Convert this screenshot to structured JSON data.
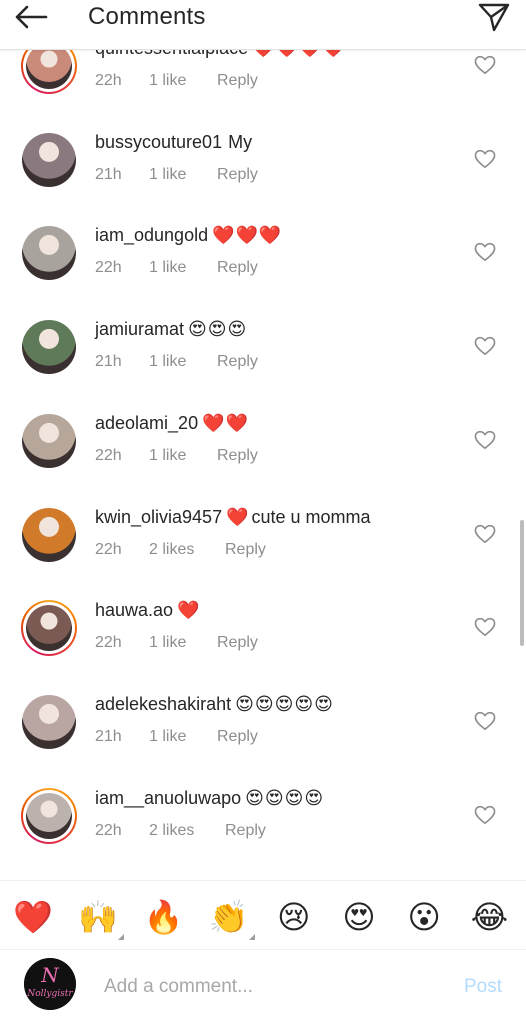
{
  "header": {
    "title": "Comments",
    "back_icon": "arrow-left-icon",
    "send_icon": "paper-plane-icon"
  },
  "comments": [
    {
      "username": "quintessentialplace",
      "text": "",
      "emoji": "❤️❤️❤️❤️",
      "time": "22h",
      "likes": "1 like",
      "reply": "Reply",
      "story_ring": true,
      "avatar_color": "#c98a7a"
    },
    {
      "username": "bussycouture01",
      "text": "My",
      "emoji": "",
      "time": "21h",
      "likes": "1 like",
      "reply": "Reply",
      "story_ring": false,
      "avatar_color": "#8a7a80"
    },
    {
      "username": "iam_odungold",
      "text": "",
      "emoji": "❤️❤️❤️",
      "time": "22h",
      "likes": "1 like",
      "reply": "Reply",
      "story_ring": false,
      "avatar_color": "#a8a39c"
    },
    {
      "username": "jamiuramat",
      "text": "",
      "emoji": "😍😍😍",
      "time": "21h",
      "likes": "1 like",
      "reply": "Reply",
      "story_ring": false,
      "avatar_color": "#5f7a58"
    },
    {
      "username": "adeolami_20",
      "text": "",
      "emoji": "❤️❤️",
      "time": "22h",
      "likes": "1 like",
      "reply": "Reply",
      "story_ring": false,
      "avatar_color": "#b7a79a"
    },
    {
      "username": "kwin_olivia9457",
      "text": "cute u momma",
      "emoji": "❤️",
      "time": "22h",
      "likes": "2 likes",
      "reply": "Reply",
      "story_ring": false,
      "avatar_color": "#d07a2a"
    },
    {
      "username": "hauwa.ao",
      "text": "",
      "emoji": "❤️",
      "time": "22h",
      "likes": "1 like",
      "reply": "Reply",
      "story_ring": true,
      "avatar_color": "#7a5a52"
    },
    {
      "username": "adelekeshakiraht",
      "text": "",
      "emoji": "😍😍😍😍😍",
      "time": "21h",
      "likes": "1 like",
      "reply": "Reply",
      "story_ring": false,
      "avatar_color": "#b9a6a2"
    },
    {
      "username": "iam__anuoluwapo",
      "text": "",
      "emoji": "😍😍😍😍",
      "time": "22h",
      "likes": "2 likes",
      "reply": "Reply",
      "story_ring": true,
      "avatar_color": "#bcb2ad"
    }
  ],
  "reactions": [
    {
      "emoji": "❤️",
      "name": "heart-emoji",
      "variant": false
    },
    {
      "emoji": "🙌",
      "name": "raised-hands-emoji",
      "variant": true
    },
    {
      "emoji": "🔥",
      "name": "fire-emoji",
      "variant": false
    },
    {
      "emoji": "👏",
      "name": "clapping-hands-emoji",
      "variant": true
    },
    {
      "emoji": "😢",
      "name": "crying-face-emoji",
      "variant": false
    },
    {
      "emoji": "😍",
      "name": "heart-eyes-emoji",
      "variant": false
    },
    {
      "emoji": "😮",
      "name": "surprised-face-emoji",
      "variant": false
    },
    {
      "emoji": "😂",
      "name": "tears-of-joy-emoji",
      "variant": false
    }
  ],
  "composer": {
    "placeholder": "Add a comment...",
    "post_label": "Post",
    "avatar_logo_text": "Nollygistr"
  },
  "colors": {
    "text": "#262626",
    "meta": "#8e8e8e",
    "post_disabled": "#b3dbff",
    "heart": "#ed1c24"
  }
}
